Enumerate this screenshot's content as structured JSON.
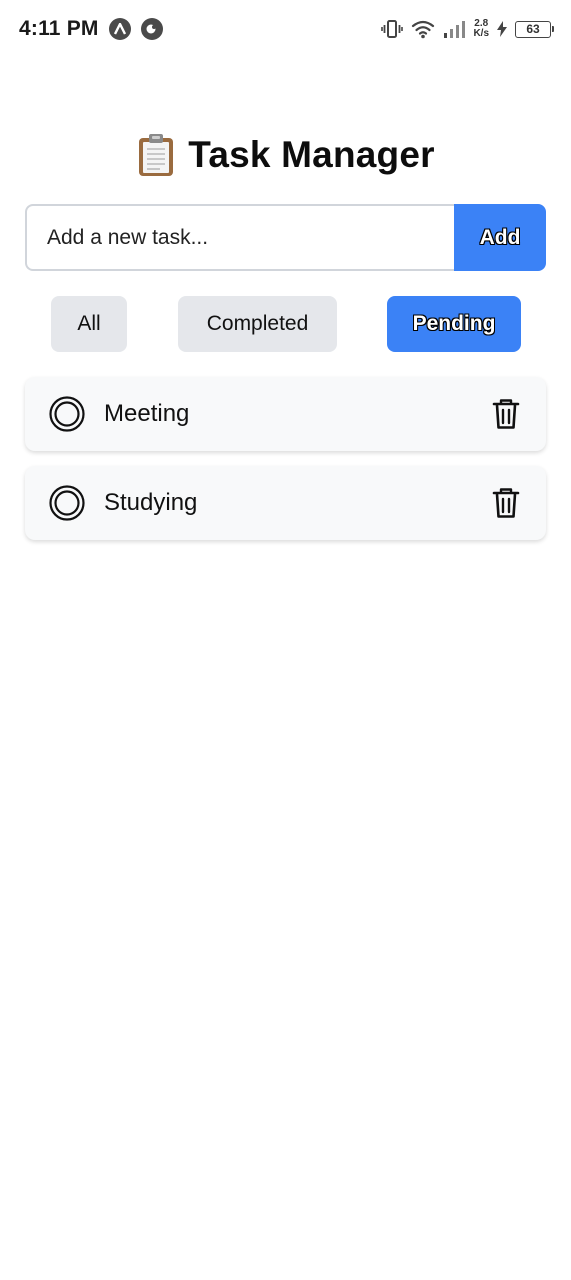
{
  "status_bar": {
    "time": "4:11 PM",
    "speed_value": "2.8",
    "speed_unit": "K/s",
    "battery": "63"
  },
  "header": {
    "icon": "clipboard-icon",
    "title": "Task Manager"
  },
  "input": {
    "placeholder": "Add a new task...",
    "value": ""
  },
  "add_button": {
    "label": "Add"
  },
  "filters": {
    "all": "All",
    "completed": "Completed",
    "pending": "Pending",
    "active": "Pending"
  },
  "tasks": [
    {
      "text": "Meeting",
      "completed": false
    },
    {
      "text": "Studying",
      "completed": false
    }
  ],
  "colors": {
    "accent": "#3b82f6",
    "filter_inactive": "#e5e7eb",
    "task_bg": "#f8f9fa",
    "input_border": "#d1d5db"
  }
}
